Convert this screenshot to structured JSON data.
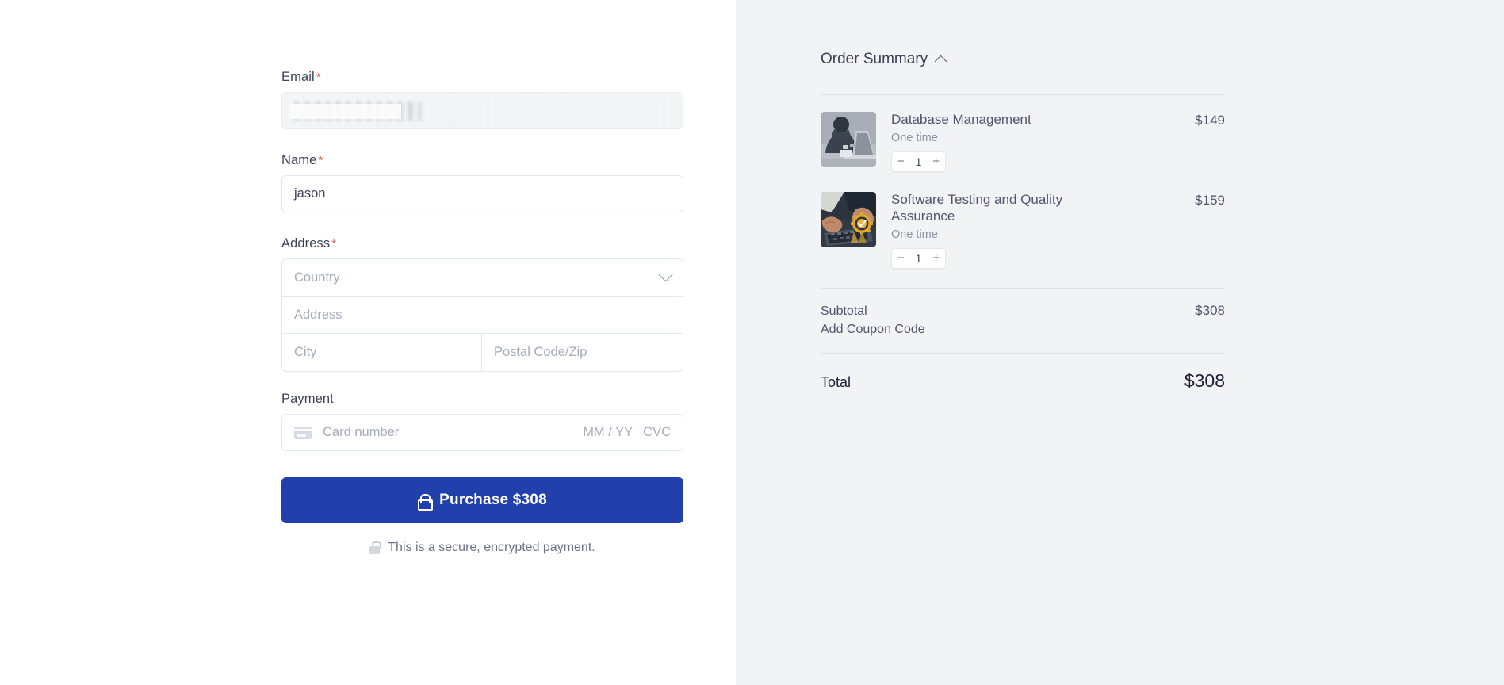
{
  "form": {
    "email": {
      "label": "Email",
      "required_mark": "*",
      "value": "",
      "redacted": true
    },
    "name": {
      "label": "Name",
      "required_mark": "*",
      "value": "jason"
    },
    "address": {
      "label": "Address",
      "required_mark": "*",
      "country_placeholder": "Country",
      "street_placeholder": "Address",
      "city_placeholder": "City",
      "postal_placeholder": "Postal Code/Zip"
    },
    "payment": {
      "label": "Payment",
      "card_placeholder": "Card number",
      "expiry_placeholder": "MM / YY",
      "cvc_placeholder": "CVC"
    },
    "purchase_button": "Purchase $308",
    "secure_note": "This is a secure, encrypted payment."
  },
  "summary": {
    "title": "Order Summary",
    "items": [
      {
        "name": "Database Management",
        "billing": "One time",
        "price": "$149",
        "quantity": "1",
        "decrement": "−",
        "increment": "+"
      },
      {
        "name": "Software Testing and Quality Assurance",
        "billing": "One time",
        "price": "$159",
        "quantity": "1",
        "decrement": "−",
        "increment": "+"
      }
    ],
    "subtotal_label": "Subtotal",
    "subtotal_value": "$308",
    "coupon_label": "Add Coupon Code",
    "total_label": "Total",
    "total_value": "$308"
  },
  "colors": {
    "accent": "#2140ac",
    "panel_bg": "#f2f3f5",
    "required": "#e25950",
    "label": "#3c4257",
    "placeholder": "#a3acb9"
  }
}
